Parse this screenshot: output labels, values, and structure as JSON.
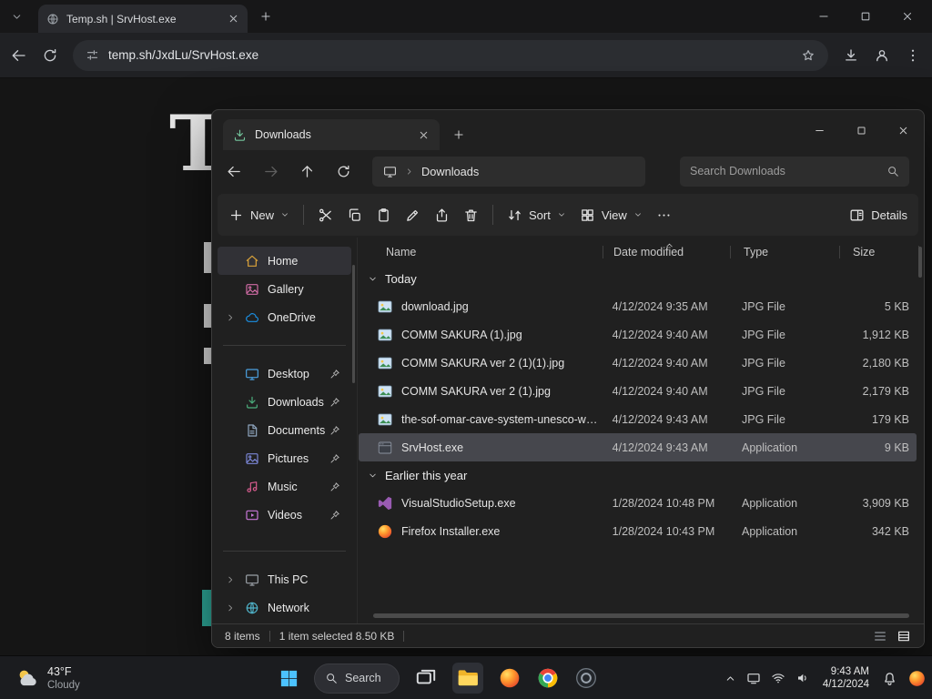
{
  "browser": {
    "tab_title": "Temp.sh | SrvHost.exe",
    "url": "temp.sh/JxdLu/SrvHost.exe"
  },
  "page": {
    "logo_letter": "T"
  },
  "explorer": {
    "tab_title": "Downloads",
    "breadcrumb": "Downloads",
    "search_placeholder": "Search Downloads",
    "toolbar": {
      "new_label": "New",
      "sort_label": "Sort",
      "view_label": "View",
      "details_label": "Details"
    },
    "columns": [
      "Name",
      "Date modified",
      "Type",
      "Size"
    ],
    "sidebar": [
      {
        "label": "Home",
        "icon": "home",
        "color": "#d9a23a",
        "active": true
      },
      {
        "label": "Gallery",
        "icon": "gallery",
        "color": "#cf6ba4"
      },
      {
        "label": "OneDrive",
        "icon": "cloud",
        "color": "#1a8fe3",
        "expandable": true
      },
      {
        "label": "Desktop",
        "icon": "monitor",
        "color": "#4ba0e0",
        "pinned": true,
        "divider_before": true
      },
      {
        "label": "Downloads",
        "icon": "download_tray",
        "color": "#4caf7d",
        "pinned": true
      },
      {
        "label": "Documents",
        "icon": "document",
        "color": "#8fa6bf",
        "pinned": true
      },
      {
        "label": "Pictures",
        "icon": "picture",
        "color": "#7b86d6",
        "pinned": true
      },
      {
        "label": "Music",
        "icon": "music",
        "color": "#d65c8e",
        "pinned": true
      },
      {
        "label": "Videos",
        "icon": "video",
        "color": "#c978d9",
        "pinned": true
      },
      {
        "label": "This PC",
        "icon": "monitor",
        "color": "#9aa0a6",
        "expandable": true,
        "divider_before": true
      },
      {
        "label": "Network",
        "icon": "globe",
        "color": "#4fb3c9",
        "expandable": true
      }
    ],
    "groups": [
      {
        "label": "Today",
        "files": [
          {
            "name": "download.jpg",
            "date": "4/12/2024 9:35 AM",
            "type": "JPG File",
            "size": "5 KB",
            "icon": "image"
          },
          {
            "name": "COMM SAKURA (1).jpg",
            "date": "4/12/2024 9:40 AM",
            "type": "JPG File",
            "size": "1,912 KB",
            "icon": "image"
          },
          {
            "name": "COMM SAKURA ver 2 (1)(1).jpg",
            "date": "4/12/2024 9:40 AM",
            "type": "JPG File",
            "size": "2,180 KB",
            "icon": "image"
          },
          {
            "name": "COMM SAKURA ver 2 (1).jpg",
            "date": "4/12/2024 9:40 AM",
            "type": "JPG File",
            "size": "2,179 KB",
            "icon": "image"
          },
          {
            "name": "the-sof-omar-cave-system-unesco-worl...",
            "date": "4/12/2024 9:43 AM",
            "type": "JPG File",
            "size": "179 KB",
            "icon": "image"
          },
          {
            "name": "SrvHost.exe",
            "date": "4/12/2024 9:43 AM",
            "type": "Application",
            "size": "9 KB",
            "icon": "app",
            "selected": true
          }
        ]
      },
      {
        "label": "Earlier this year",
        "files": [
          {
            "name": "VisualStudioSetup.exe",
            "date": "1/28/2024 10:48 PM",
            "type": "Application",
            "size": "3,909 KB",
            "icon": "vs"
          },
          {
            "name": "Firefox Installer.exe",
            "date": "1/28/2024 10:43 PM",
            "type": "Application",
            "size": "342 KB",
            "icon": "firefox"
          }
        ]
      }
    ],
    "status_left": "8 items",
    "status_selected": "1 item selected 8.50 KB"
  },
  "taskbar": {
    "weather_temp": "43°F",
    "weather_condition": "Cloudy",
    "search_label": "Search",
    "time": "9:43 AM",
    "date": "4/12/2024"
  }
}
